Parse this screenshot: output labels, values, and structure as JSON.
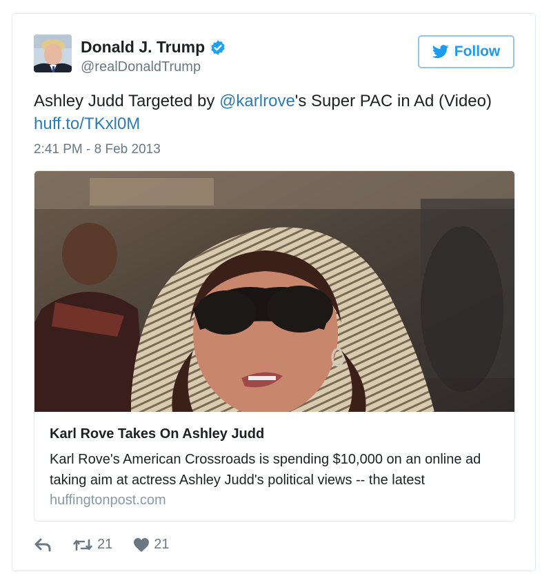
{
  "author": {
    "display_name": "Donald J. Trump",
    "handle": "@realDonaldTrump",
    "verified_icon": "verified-badge-icon"
  },
  "follow_button": {
    "label": "Follow",
    "icon": "twitter-bird-icon"
  },
  "tweet": {
    "text_before": "Ashley Judd Targeted by ",
    "mention": "@karlrove",
    "text_after": "'s Super PAC in Ad (Video)",
    "link": "huff.to/TKxl0M",
    "timestamp": "2:41 PM - 8 Feb 2013"
  },
  "link_card": {
    "title": "Karl Rove Takes On Ashley Judd",
    "description": "Karl Rove's American Crossroads is spending $10,000 on an online ad taking aim at actress Ashley Judd's political views -- the latest",
    "domain": "huffingtonpost.com"
  },
  "actions": {
    "reply_icon": "reply-icon",
    "retweet_icon": "retweet-icon",
    "retweet_count": "21",
    "like_icon": "heart-icon",
    "like_count": "21"
  },
  "colors": {
    "link": "#2b7bb9",
    "follow_blue": "#1d9bf0",
    "verified_blue": "#1da1f2",
    "muted": "#697882",
    "border": "#e1e8ed"
  }
}
